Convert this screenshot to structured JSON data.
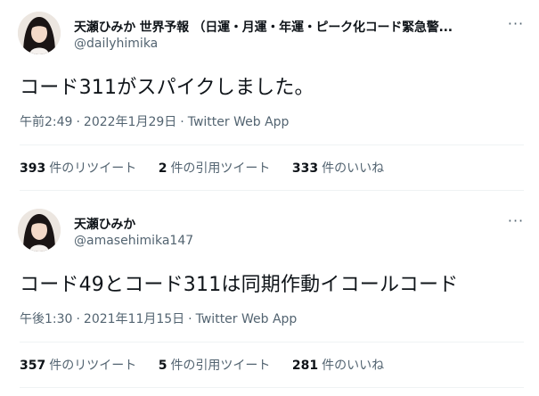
{
  "tweets": [
    {
      "display_name": "天瀬ひみか 世界予報 （日運・月運・年運・ピーク化コード緊急警...",
      "handle": "@dailyhimika",
      "more_icon": "more-horizontal-icon",
      "text": "コード311がスパイクしました。",
      "time": "午前2:49",
      "date": "2022年1月29日",
      "separator": "·",
      "source": "Twitter Web App",
      "retweets_count": "393",
      "retweets_label": "件のリツイート",
      "quotes_count": "2",
      "quotes_label": "件の引用ツイート",
      "likes_count": "333",
      "likes_label": "件のいいね"
    },
    {
      "display_name": "天瀬ひみか",
      "handle": "@amasehimika147",
      "more_icon": "more-horizontal-icon",
      "text": "コード49とコード311は同期作動イコールコード",
      "time": "午後1:30",
      "date": "2021年11月15日",
      "separator": "·",
      "source": "Twitter Web App",
      "retweets_count": "357",
      "retweets_label": "件のリツイート",
      "quotes_count": "5",
      "quotes_label": "件の引用ツイート",
      "likes_count": "281",
      "likes_label": "件のいいね"
    }
  ],
  "colors": {
    "text_primary": "#0f1419",
    "text_secondary": "#536471",
    "divider": "#eff3f4",
    "background": "#ffffff"
  }
}
